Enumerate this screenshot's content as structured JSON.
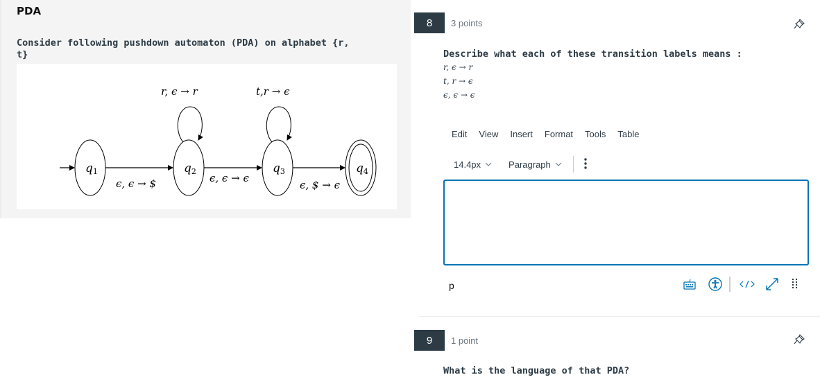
{
  "left_panel": {
    "title": "PDA",
    "question_line1": "Consider following pushdown automaton (PDA) on alphabet {r,",
    "question_line2": "t}",
    "diagram": {
      "states": [
        {
          "id": "q1",
          "label": "q",
          "sub": "1",
          "initial": true,
          "accepting": false
        },
        {
          "id": "q2",
          "label": "q",
          "sub": "2",
          "initial": false,
          "accepting": false
        },
        {
          "id": "q3",
          "label": "q",
          "sub": "3",
          "initial": false,
          "accepting": false
        },
        {
          "id": "q4",
          "label": "q",
          "sub": "4",
          "initial": false,
          "accepting": true
        }
      ],
      "transitions": [
        {
          "from": "q1",
          "to": "q2",
          "label": "ϵ, ϵ → $"
        },
        {
          "from": "q2",
          "to": "q2",
          "label": "r, ϵ → r"
        },
        {
          "from": "q2",
          "to": "q3",
          "label": "ϵ, ϵ → ϵ"
        },
        {
          "from": "q3",
          "to": "q3",
          "label": "t,r → ϵ"
        },
        {
          "from": "q3",
          "to": "q4",
          "label": "ϵ, $ → ϵ"
        }
      ]
    }
  },
  "questions": [
    {
      "number": "8",
      "points": "3 points",
      "text": "Describe what each of these transition labels means :",
      "transitions": [
        "r, ϵ → r",
        "t, r → ϵ",
        "ϵ, ϵ → ϵ"
      ],
      "editor": {
        "menu": [
          "Edit",
          "View",
          "Insert",
          "Format",
          "Tools",
          "Table"
        ],
        "font_size": "14.4px",
        "block_format": "Paragraph",
        "content": "",
        "path": "p",
        "status_icons": [
          "keyboard-icon",
          "accessibility-icon",
          "html-source-icon",
          "fullscreen-icon",
          "resize-handle-icon"
        ]
      }
    },
    {
      "number": "9",
      "points": "1 point",
      "text": "What is the language of that PDA?"
    }
  ],
  "colors": {
    "badge_bg": "#2d3b45",
    "editor_border": "#0374b5",
    "icon_blue": "#0374b5",
    "panel_bg": "#f4f4f4"
  }
}
